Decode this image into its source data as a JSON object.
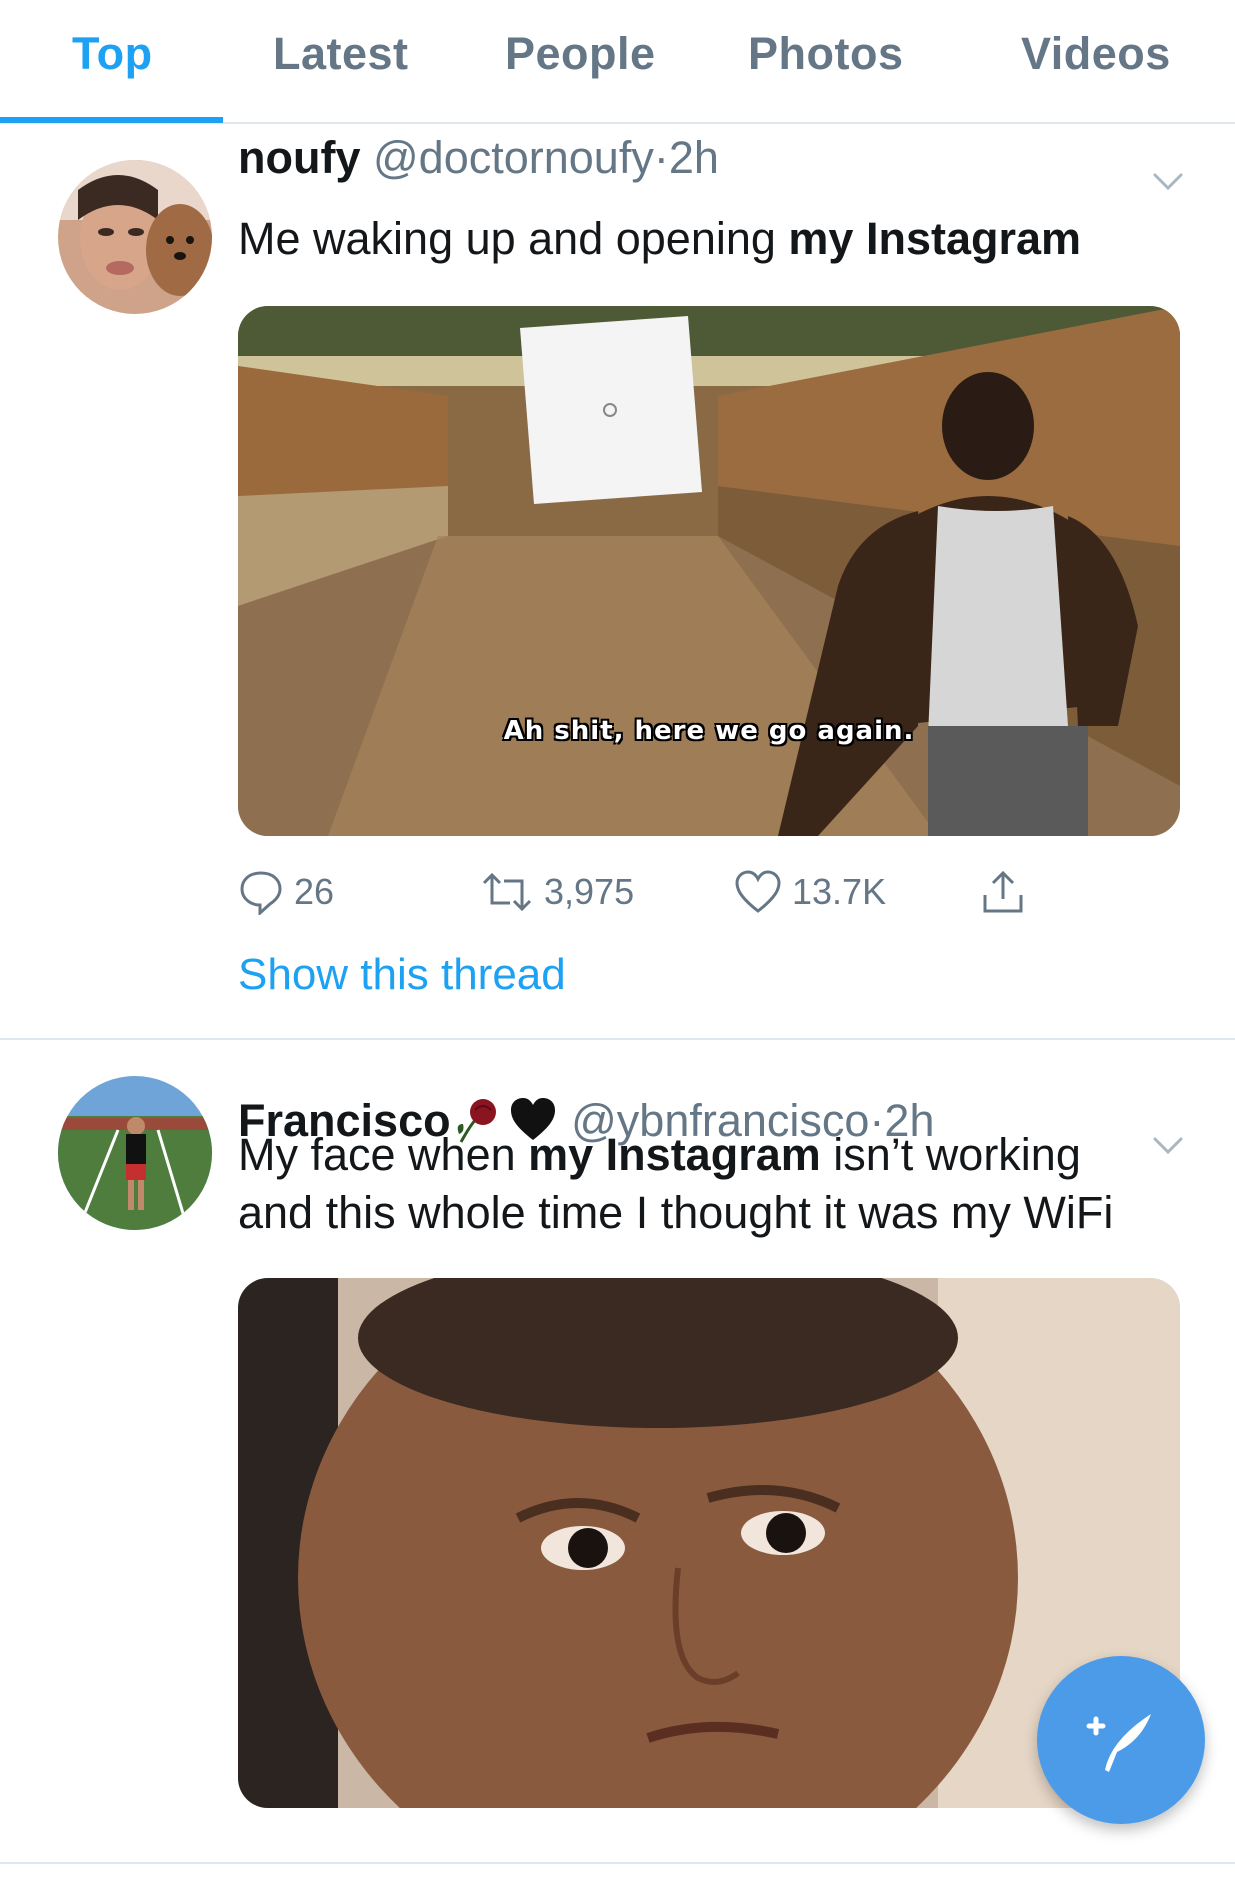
{
  "tabs": [
    {
      "label": "Top",
      "active": true
    },
    {
      "label": "Latest",
      "active": false
    },
    {
      "label": "People",
      "active": false
    },
    {
      "label": "Photos",
      "active": false
    },
    {
      "label": "Videos",
      "active": false
    }
  ],
  "tweets": [
    {
      "display_name": "noufy",
      "handle": "@doctornoufy",
      "dot": "·",
      "time": "2h",
      "text_plain": "Me waking up and opening ",
      "text_bold": "my Instagram",
      "text_plain_2": "",
      "media_caption": "Ah shit, here we go again.",
      "replies": "26",
      "retweets": "3,975",
      "likes": "13.7K",
      "show_thread": "Show this thread"
    },
    {
      "display_name": "Francisco",
      "handle": "@ybnfrancisco",
      "dot": "·",
      "time": "2h",
      "text_plain": "My face when ",
      "text_bold": "my Instagram",
      "text_plain_2": " isn’t working and this whole time I thought it was my WiFi"
    }
  ],
  "colors": {
    "accent": "#1da1f2",
    "muted": "#657786",
    "fab": "#4b9be8"
  },
  "icons": [
    "reply-icon",
    "retweet-icon",
    "like-icon",
    "share-icon",
    "chevron-down-icon",
    "compose-tweet-icon",
    "rose-emoji-icon",
    "black-heart-emoji-icon"
  ]
}
